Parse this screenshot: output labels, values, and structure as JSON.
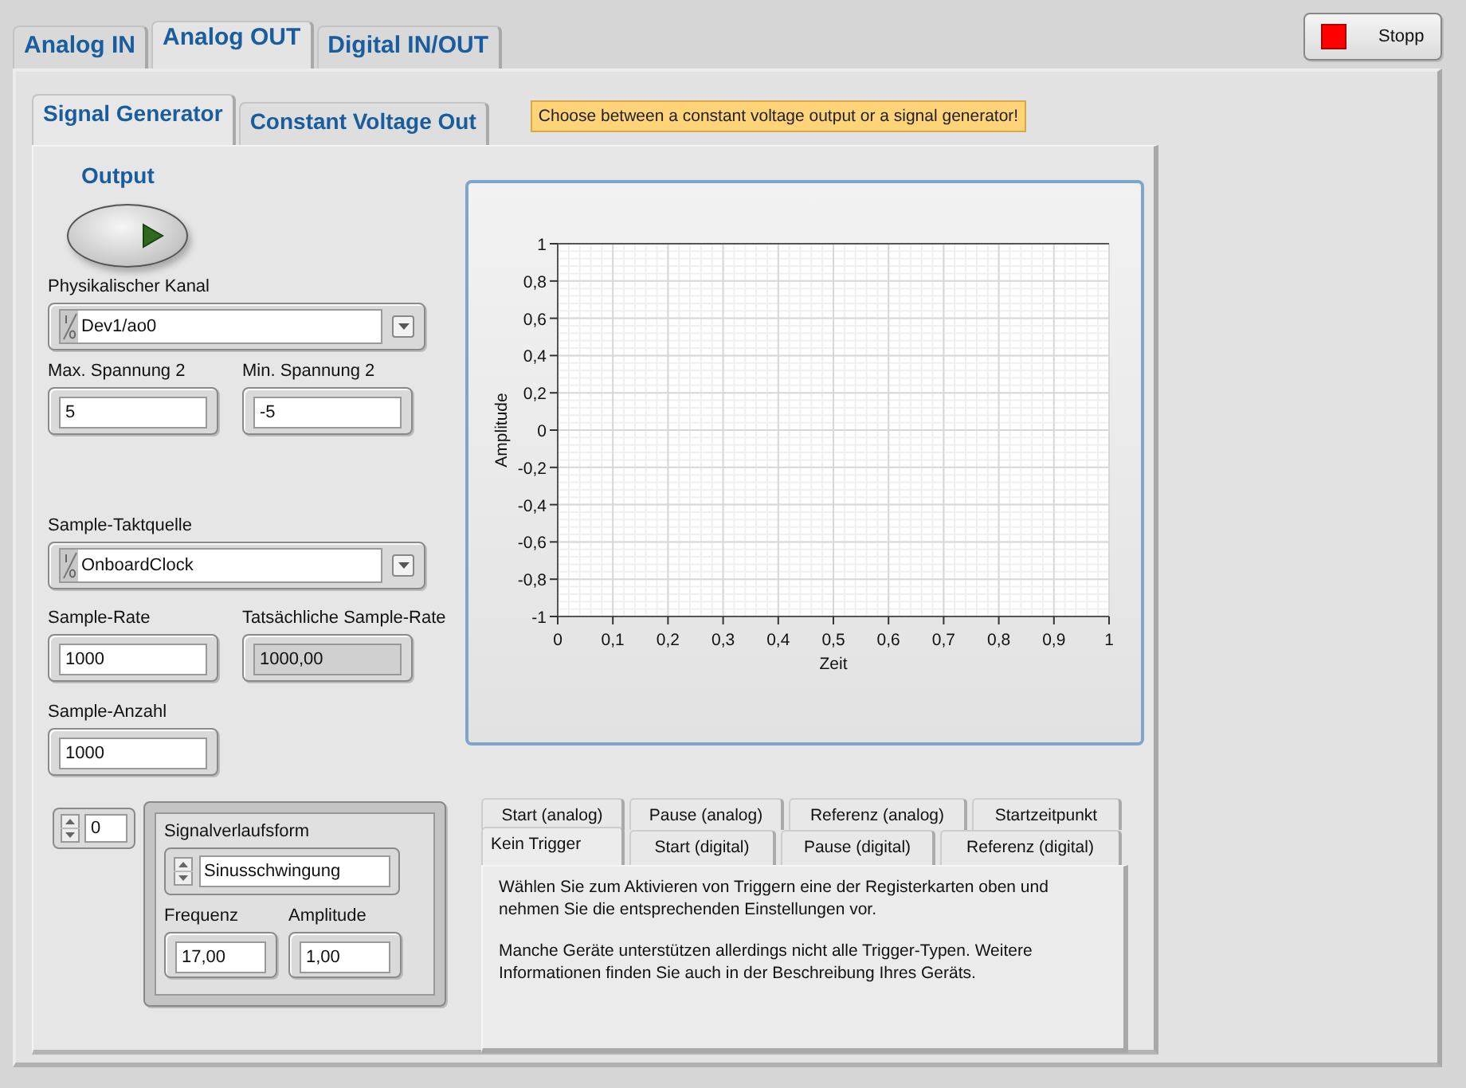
{
  "top_tabs": [
    {
      "label": "Analog IN",
      "selected": false
    },
    {
      "label": "Analog OUT",
      "selected": true
    },
    {
      "label": "Digital IN/OUT",
      "selected": false
    }
  ],
  "stop_button": {
    "label": "Stopp"
  },
  "sub_tabs": [
    {
      "label": "Signal Generator",
      "selected": true
    },
    {
      "label": "Constant Voltage Out",
      "selected": false
    }
  ],
  "note": "Choose between a constant voltage output or a signal generator!",
  "output": {
    "label": "Output"
  },
  "channel": {
    "label": "Physikalischer Kanal",
    "value": "Dev1/ao0"
  },
  "voltage_fields": [
    {
      "label": "Max. Spannung 2",
      "value": "5",
      "kind": "control"
    },
    {
      "label": "Min. Spannung 2",
      "value": "-5",
      "kind": "control"
    }
  ],
  "clock": {
    "label": "Sample-Taktquelle",
    "value": "OnboardClock"
  },
  "rate_fields": [
    {
      "label": "Sample-Rate",
      "value": "1000",
      "kind": "control"
    },
    {
      "label": "Tatsächliche Sample-Rate",
      "value": "1000,00",
      "kind": "indicator"
    }
  ],
  "count_fields": [
    {
      "label": "Sample-Anzahl",
      "value": "1000",
      "kind": "control"
    }
  ],
  "array_index": "0",
  "waveform": {
    "label": "Signalverlaufsform",
    "value": "Sinusschwingung",
    "fields": [
      {
        "label": "Frequenz",
        "value": "17,00",
        "kind": "control"
      },
      {
        "label": "Amplitude",
        "value": "1,00",
        "kind": "control"
      }
    ]
  },
  "graph": {
    "chart_data": {
      "type": "line",
      "grid": true,
      "xlabel": "Zeit",
      "ylabel": "Amplitude",
      "xlim": [
        0,
        1
      ],
      "ylim": [
        -1,
        1
      ],
      "xticks": [
        0,
        {
          "value": 0.1,
          "label": "0,1"
        },
        {
          "value": 0.2,
          "label": "0,2"
        },
        {
          "value": 0.3,
          "label": "0,3"
        },
        {
          "value": 0.4,
          "label": "0,4"
        },
        {
          "value": 0.5,
          "label": "0,5"
        },
        {
          "value": 0.6,
          "label": "0,6"
        },
        {
          "value": 0.7,
          "label": "0,7"
        },
        {
          "value": 0.8,
          "label": "0,8"
        },
        {
          "value": 0.9,
          "label": "0,9"
        },
        1
      ],
      "yticks": [
        1,
        {
          "value": 0.8,
          "label": "0,8"
        },
        {
          "value": 0.6,
          "label": "0,6"
        },
        {
          "value": 0.4,
          "label": "0,4"
        },
        {
          "value": 0.2,
          "label": "0,2"
        },
        0,
        {
          "value": -0.2,
          "label": "-0,2"
        },
        {
          "value": -0.4,
          "label": "-0,4"
        },
        {
          "value": -0.6,
          "label": "-0,6"
        },
        {
          "value": -0.8,
          "label": "-0,8"
        },
        -1
      ]
    }
  },
  "trigger": {
    "back_tabs": [
      {
        "label": "Start (analog)",
        "selected": false
      },
      {
        "label": "Pause (analog)",
        "selected": false
      },
      {
        "label": "Referenz (analog)",
        "selected": false
      },
      {
        "label": "Startzeitpunkt",
        "selected": false
      }
    ],
    "front_tabs": [
      {
        "label": "Kein Trigger",
        "selected": true
      },
      {
        "label": "Start (digital)",
        "selected": false
      },
      {
        "label": "Pause (digital)",
        "selected": false
      },
      {
        "label": "Referenz (digital)",
        "selected": false
      }
    ],
    "paragraphs": [
      "Wählen Sie zum Aktivieren von Triggern eine der Registerkarten oben und nehmen Sie die entsprechenden Einstellungen vor.",
      "Manche Geräte unterstützen allerdings nicht alle Trigger-Typen. Weitere Informationen finden Sie auch in der Beschreibung Ihres Geräts."
    ]
  }
}
